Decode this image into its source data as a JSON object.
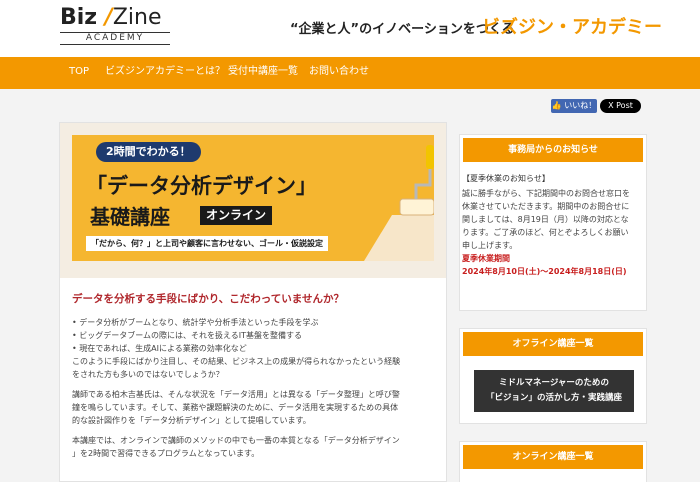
{
  "header": {
    "logo_main_a": "Biz",
    "logo_slash": "/",
    "logo_main_b": "Zine",
    "logo_sub": "ACADEMY",
    "tagline": "“企業と人”のイノベーションをつくる",
    "brand": "ビズジン・アカデミー"
  },
  "nav": {
    "items": [
      "TOP",
      "ビズジンアカデミーとは？",
      "受付中講座一覧",
      "お問い合わせ"
    ]
  },
  "social": {
    "like_label": "いいね！",
    "post_label": "X Post"
  },
  "banner": {
    "pill": "2時間でわかる！",
    "title1": "「データ分析デザイン」",
    "title2": "基礎講座",
    "online": "オンライン",
    "sub": "「だから、何？」と上司や顧客に言わせない、ゴール・仮説設定"
  },
  "article": {
    "heading": "データを分析する手段にばかり、こだわっていませんか？",
    "bullets": [
      "• データ分析がブームとなり、統計学や分析手法といった手段を学ぶ",
      "• ビッグデータブームの際には、それを扱えるIT基盤を整備する",
      "• 現在であれば、生成AIによる業務の効率化など"
    ],
    "para1": [
      "このように手段にばかり注目し、その結果、ビジネス上の成果が得られなかったという経験",
      "をされた方も多いのではないでしょうか？"
    ],
    "para2": [
      "講師である柏木吉基氏は、そんな状況を「データ活用」とは異なる「データ整理」と呼び警",
      "鐘を鳴らしています。そして、業務や課題解決のために、データ活用を実現するための具体",
      "的な設計図作りを「データ分析デザイン」として提唱しています。"
    ],
    "para3": [
      "本講座では、オンラインで講師のメソッドの中でも一番の本質となる「データ分析デザイン",
      "」を2時間で習得できるプログラムとなっています。"
    ]
  },
  "sidebar": {
    "notice_head": "事務局からのお知らせ",
    "notice_title": "【夏季休業のお知らせ】",
    "notice_lines": [
      "誠に勝手ながら、下記期間中のお問合せ窓口を",
      "休業させていただきます。期間中のお問合せに",
      "関しましては、8月19日（月）以降の対応とな",
      "ります。ご了承のほど、何とぞよろしくお願い",
      "申し上げます。"
    ],
    "holiday_label": "夏季休業期間",
    "holiday_dates": "2024年8月10日(土)〜2024年8月18日(日)",
    "offline_head": "オフライン講座一覧",
    "offline_line1": "ミドルマネージャーのための",
    "offline_line2": "「ビジョン」の活かし方・実践講座",
    "online_head": "オンライン講座一覧"
  },
  "colors": {
    "accent": "#f39800",
    "alert": "#c81e1e",
    "heading_red": "#b0272c"
  }
}
